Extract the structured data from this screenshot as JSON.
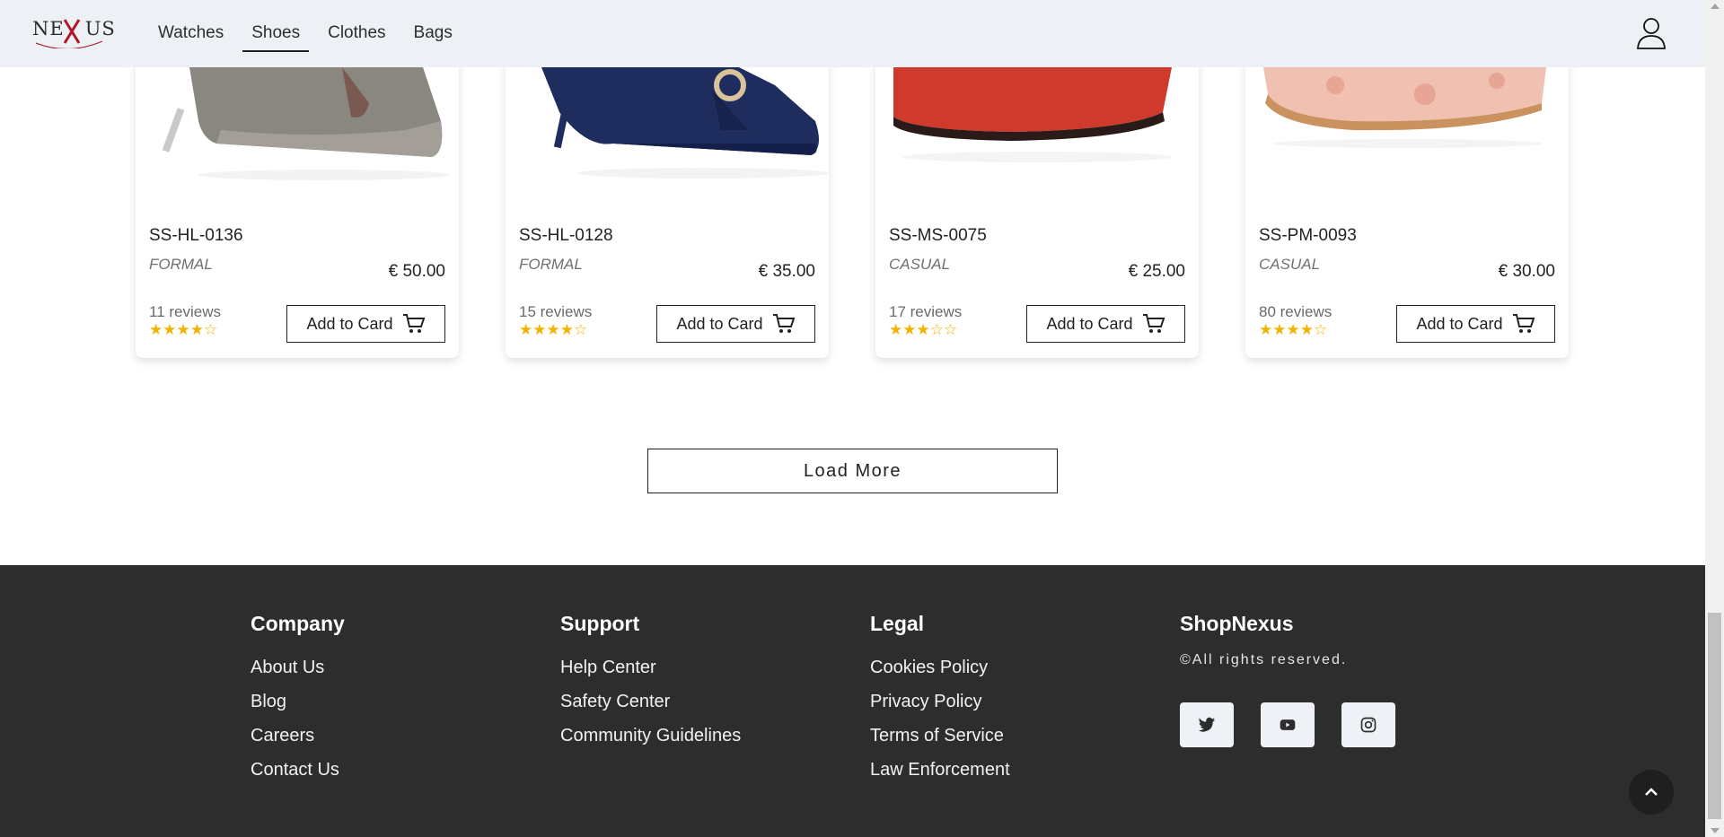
{
  "header": {
    "logo_text": "NEXUS",
    "nav": [
      {
        "label": "Watches",
        "active": false
      },
      {
        "label": "Shoes",
        "active": true
      },
      {
        "label": "Clothes",
        "active": false
      },
      {
        "label": "Bags",
        "active": false
      }
    ],
    "user_icon": "user-icon"
  },
  "products": [
    {
      "name": "SS-HL-0136",
      "category": "FORMAL",
      "price": "€ 50.00",
      "reviews": "11 reviews",
      "rating": 4,
      "stars": "★★★★☆",
      "button": "Add to Card",
      "image": "silver-heel-shoe"
    },
    {
      "name": "SS-HL-0128",
      "category": "FORMAL",
      "price": "€ 35.00",
      "reviews": "15 reviews",
      "rating": 4,
      "stars": "★★★★☆",
      "button": "Add to Card",
      "image": "navy-heel-shoe"
    },
    {
      "name": "SS-MS-0075",
      "category": "CASUAL",
      "price": "€ 25.00",
      "reviews": "17 reviews",
      "rating": 3,
      "stars": "★★★☆☆",
      "button": "Add to Card",
      "image": "red-loafer-shoe"
    },
    {
      "name": "SS-PM-0093",
      "category": "CASUAL",
      "price": "€ 30.00",
      "reviews": "80 reviews",
      "rating": 4,
      "stars": "★★★★☆",
      "button": "Add to Card",
      "image": "floral-flat-shoe"
    }
  ],
  "load_more": "Load More",
  "footer": {
    "columns": [
      {
        "heading": "Company",
        "links": [
          "About Us",
          "Blog",
          "Careers",
          "Contact Us"
        ]
      },
      {
        "heading": "Support",
        "links": [
          "Help Center",
          "Safety Center",
          "Community Guidelines"
        ]
      },
      {
        "heading": "Legal",
        "links": [
          "Cookies Policy",
          "Privacy Policy",
          "Terms of Service",
          "Law Enforcement"
        ]
      }
    ],
    "brand": "ShopNexus",
    "rights": "©All rights reserved.",
    "socials": [
      "twitter-icon",
      "youtube-icon",
      "instagram-icon"
    ]
  },
  "colors": {
    "header_bg": "#edf1f6",
    "footer_bg": "#2d2d2d",
    "star": "#f0b400"
  }
}
